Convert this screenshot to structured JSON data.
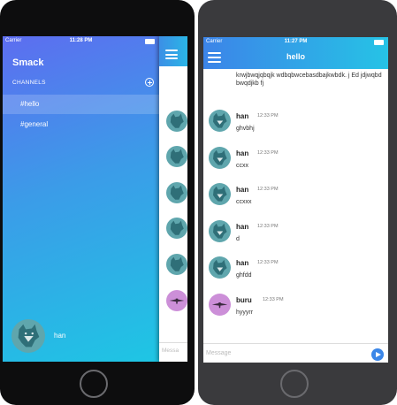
{
  "status_left": {
    "carrier": "Carrier",
    "time": "11:28 PM"
  },
  "status_right": {
    "carrier": "Carrier",
    "time": "11:27 PM"
  },
  "drawer": {
    "app_title": "Smack",
    "channels_header": "CHANNELS",
    "channels": [
      "#hello",
      "#general"
    ],
    "selected_channel": "#hello",
    "username": "han"
  },
  "peek": {
    "input_placeholder": "Messa"
  },
  "chat": {
    "title": "hello",
    "partial_message_text": "krwjbwqjqbqjk wdbqbwcebasdbajkwbdk. j Ed jdjwqbd bwqdjkb fj",
    "messages": [
      {
        "user": "han",
        "time": "12:33 PM",
        "text": "ghvbhj",
        "avatar": "wolf-avatar"
      },
      {
        "user": "han",
        "time": "12:33 PM",
        "text": "ccxx",
        "avatar": "wolf-avatar"
      },
      {
        "user": "han",
        "time": "12:33 PM",
        "text": "ccxxx",
        "avatar": "wolf-avatar"
      },
      {
        "user": "han",
        "time": "12:33 PM",
        "text": "d",
        "avatar": "wolf-avatar"
      },
      {
        "user": "han",
        "time": "12:33 PM",
        "text": "ghfdd",
        "avatar": "wolf-avatar"
      },
      {
        "user": "buru",
        "time": "12:33 PM",
        "text": "hyyyrr",
        "avatar": "pink-avatar"
      }
    ],
    "input_placeholder": "Message"
  },
  "colors": {
    "drawer_gradient_start": "#5d6df0",
    "drawer_gradient_end": "#1ec6e4",
    "navbar_start": "#3c84e8",
    "navbar_end": "#26c3e6",
    "avatar_teal": "#5fa6ad",
    "avatar_pink": "#cc8fd8",
    "send_blue": "#3a86e8"
  },
  "icons": {
    "menu": "hamburger-menu-icon",
    "add_channel": "plus-circle-icon",
    "send": "send-arrow-icon",
    "wifi": "wifi-icon",
    "battery": "battery-icon"
  }
}
